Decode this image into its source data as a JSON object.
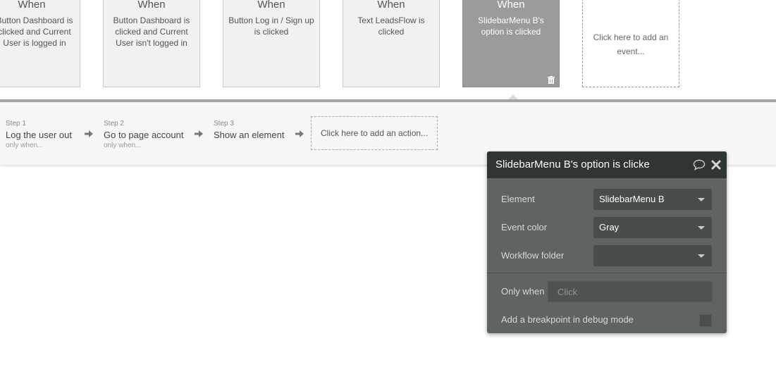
{
  "events": [
    {
      "when": "When",
      "description": "Button Dashboard is clicked and Current User is logged in"
    },
    {
      "when": "When",
      "description": "Button Dashboard is clicked and Current User isn't logged in"
    },
    {
      "when": "When",
      "description": "Button Log in / Sign up is clicked"
    },
    {
      "when": "When",
      "description": "Text LeadsFlow is clicked"
    },
    {
      "when": "When",
      "description": "SlidebarMenu B's option is clicked"
    }
  ],
  "add_event_label": "Click here to add an event...",
  "steps": [
    {
      "number": "Step 1",
      "title": "Log the user out",
      "condition": "only when..."
    },
    {
      "number": "Step 2",
      "title": "Go to page account",
      "condition": "only when..."
    },
    {
      "number": "Step 3",
      "title": "Show an element",
      "condition": ""
    }
  ],
  "add_action_label": "Click here to add an action...",
  "panel": {
    "title": "SlidebarMenu B's option is clicked",
    "element_label": "Element",
    "element_value": "SlidebarMenu B",
    "event_color_label": "Event color",
    "event_color_value": "Gray",
    "workflow_folder_label": "Workflow folder",
    "workflow_folder_value": "",
    "only_when_label": "Only when",
    "only_when_placeholder": "Click",
    "breakpoint_label": "Add a breakpoint in debug mode"
  },
  "colors": {
    "selected_card": "#9b9b9b",
    "panel_bg": "#5f6363",
    "panel_header": "#2f3434"
  }
}
